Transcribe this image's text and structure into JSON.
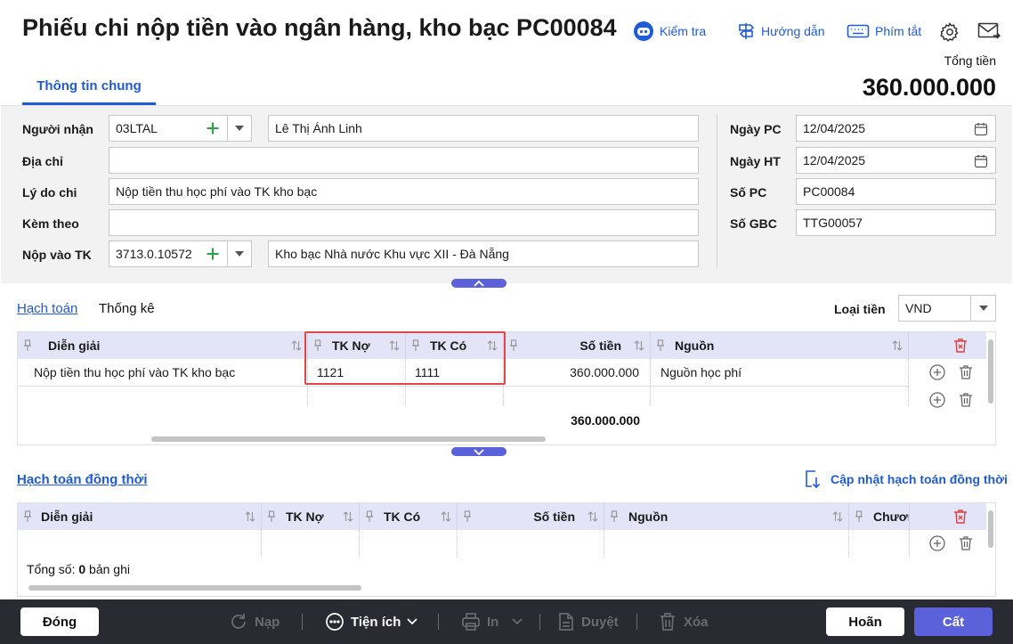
{
  "header": {
    "title": "Phiếu chi nộp tiền vào ngân hàng, kho bạc PC00084",
    "kiem_tra": "Kiểm tra",
    "huong_dan": "Hướng dẫn",
    "phim_tat": "Phím tắt",
    "tong_tien_label": "Tổng tiền",
    "tong_tien_value": "360.000.000"
  },
  "tabs": {
    "thong_tin_chung": "Thông tin chung"
  },
  "form": {
    "nguoi_nhan_label": "Người nhận",
    "nguoi_nhan_code": "03LTAL",
    "nguoi_nhan_name": "Lê Thị Ánh Linh",
    "dia_chi_label": "Địa chỉ",
    "dia_chi_value": "",
    "ly_do_chi_label": "Lý do chi",
    "ly_do_chi_value": "Nộp tiền thu học phí vào TK kho bạc",
    "kem_theo_label": "Kèm theo",
    "kem_theo_value": "",
    "nop_vao_tk_label": "Nộp vào TK",
    "nop_vao_tk_code": "3713.0.10572",
    "nop_vao_tk_name": "Kho bạc Nhà nước Khu vực XII - Đà Nẵng",
    "ngay_pc_label": "Ngày PC",
    "ngay_pc_value": "12/04/2025",
    "ngay_ht_label": "Ngày HT",
    "ngay_ht_value": "12/04/2025",
    "so_pc_label": "Số PC",
    "so_pc_value": "PC00084",
    "so_gbc_label": "Số GBC",
    "so_gbc_value": "TTG00057"
  },
  "section1": {
    "tab_hach_toan": "Hạch toán",
    "tab_thong_ke": "Thống kê",
    "loai_tien_label": "Loại tiền",
    "loai_tien_value": "VND",
    "columns": [
      "Diễn giải",
      "TK Nợ",
      "TK Có",
      "Số tiền",
      "Nguồn"
    ],
    "rows": [
      {
        "dien_giai": "Nộp tiền thu học phí vào TK kho bạc",
        "tk_no": "1121",
        "tk_co": "1111",
        "so_tien": "360.000.000",
        "nguon": "Nguồn học phí"
      }
    ],
    "total": "360.000.000"
  },
  "section2": {
    "title": "Hạch toán đồng thời",
    "update_label": "Cập nhật hạch toán đồng thời",
    "columns": [
      "Diễn giải",
      "TK Nợ",
      "TK Có",
      "Số tiền",
      "Nguồn",
      "Chươn"
    ],
    "count_prefix": "Tổng số: ",
    "count_value": "0",
    "count_suffix": " bản ghi"
  },
  "footer": {
    "dong": "Đóng",
    "nap": "Nạp",
    "tien_ich": "Tiện ích",
    "in": "In",
    "duyet": "Duyệt",
    "xoa": "Xóa",
    "hoan": "Hoãn",
    "cat": "Cất"
  },
  "colors": {
    "accent": "#1f5bd6",
    "primary_button": "#5b62d9",
    "grid_header": "#e4e4f8",
    "highlight": "#e04848",
    "footer_bg": "#2a2a32"
  }
}
